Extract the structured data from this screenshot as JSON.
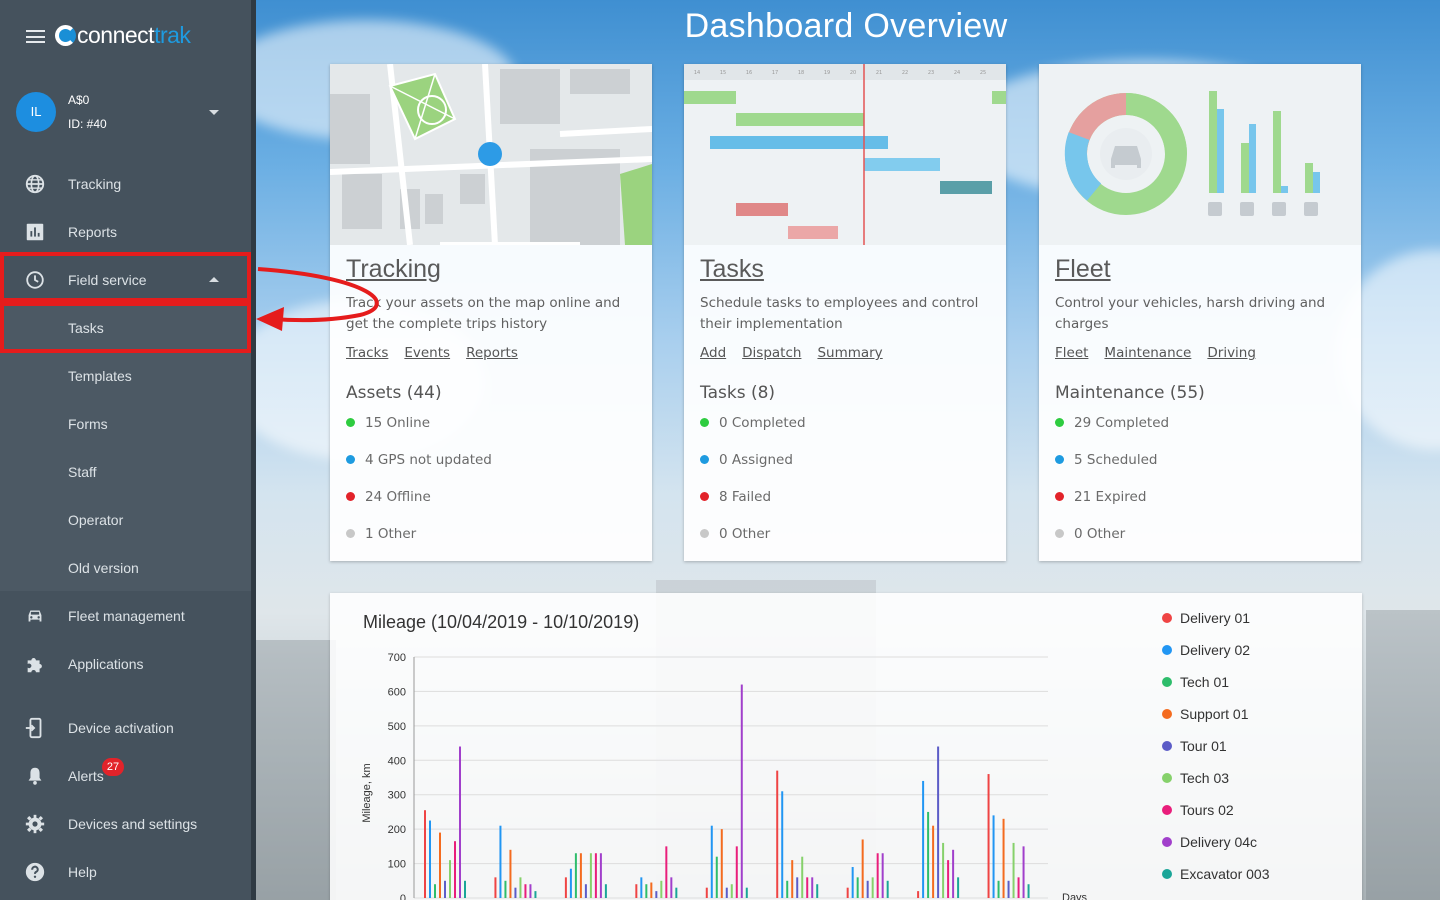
{
  "app": {
    "logo_connect": "connect",
    "logo_trak": "trak"
  },
  "user": {
    "initials": "IL",
    "name": "A$0",
    "id": "ID: #40"
  },
  "nav": {
    "tracking": "Tracking",
    "reports": "Reports",
    "field_service": "Field service",
    "tasks": "Tasks",
    "templates": "Templates",
    "forms": "Forms",
    "staff": "Staff",
    "operator": "Operator",
    "old_version": "Old version",
    "fleet_management": "Fleet management",
    "applications": "Applications",
    "device_activation": "Device activation",
    "alerts": "Alerts",
    "alerts_count": "27",
    "devices_settings": "Devices and settings",
    "help": "Help"
  },
  "page": {
    "title": "Dashboard Overview"
  },
  "cards": {
    "tracking": {
      "title": "Tracking",
      "desc": "Track your assets on the map online and get the complete trips history",
      "links": [
        "Tracks",
        "Events",
        "Reports"
      ],
      "stat_head": "Assets (44)",
      "stats": [
        "15 Online",
        "4 GPS not updated",
        "24 Offline",
        "1 Other"
      ]
    },
    "tasks": {
      "title": "Tasks",
      "desc": "Schedule tasks to employees and control their implementation",
      "links": [
        "Add",
        "Dispatch",
        "Summary"
      ],
      "stat_head": "Tasks (8)",
      "stats": [
        "0 Completed",
        "0 Assigned",
        "8 Failed",
        "0 Other"
      ],
      "gantt_days": [
        "14",
        "15",
        "16",
        "17",
        "18",
        "19",
        "20",
        "21",
        "22",
        "23",
        "24",
        "25",
        "26"
      ]
    },
    "fleet": {
      "title": "Fleet",
      "desc": "Control your vehicles, harsh driving and charges",
      "links": [
        "Fleet",
        "Maintenance",
        "Driving"
      ],
      "stat_head": "Maintenance (55)",
      "stats": [
        "29 Completed",
        "5 Scheduled",
        "21 Expired",
        "0 Other"
      ]
    }
  },
  "status_colors": [
    "#2ecc40",
    "#1e9be0",
    "#e2232a",
    "#c8c8c8"
  ],
  "chart_data": {
    "type": "bar",
    "title": "Mileage (10/04/2019 - 10/10/2019)",
    "ylabel": "Mileage, km",
    "xlabel": "Days",
    "ylim": [
      0,
      700
    ],
    "yticks": [
      "0",
      "100",
      "200",
      "300",
      "400",
      "500",
      "600",
      "700"
    ],
    "series": [
      {
        "name": "Delivery 01",
        "color": "#ef4444",
        "values": [
          255,
          60,
          60,
          40,
          30,
          370,
          30,
          20,
          360
        ]
      },
      {
        "name": "Delivery 02",
        "color": "#2196f3",
        "values": [
          225,
          210,
          85,
          60,
          210,
          310,
          90,
          340,
          240
        ]
      },
      {
        "name": "Tech 01",
        "color": "#2ebd6b",
        "values": [
          40,
          50,
          130,
          40,
          120,
          50,
          60,
          250,
          50
        ]
      },
      {
        "name": "Support 01",
        "color": "#f46b1f",
        "values": [
          190,
          140,
          130,
          45,
          200,
          110,
          170,
          210,
          230
        ]
      },
      {
        "name": "Tour 01",
        "color": "#5c5cc7",
        "values": [
          50,
          30,
          40,
          20,
          30,
          60,
          50,
          440,
          50
        ]
      },
      {
        "name": "Tech 03",
        "color": "#86d16b",
        "values": [
          110,
          60,
          130,
          50,
          40,
          120,
          60,
          160,
          160
        ]
      },
      {
        "name": "Tours 02",
        "color": "#e91e7b",
        "values": [
          165,
          40,
          130,
          150,
          150,
          60,
          130,
          110,
          60
        ]
      },
      {
        "name": "Delivery 04c",
        "color": "#a13fcb",
        "values": [
          440,
          40,
          130,
          60,
          620,
          60,
          130,
          140,
          150
        ]
      },
      {
        "name": "Excavator 003",
        "color": "#1aa598",
        "values": [
          50,
          20,
          40,
          30,
          30,
          40,
          50,
          60,
          40
        ]
      }
    ]
  }
}
